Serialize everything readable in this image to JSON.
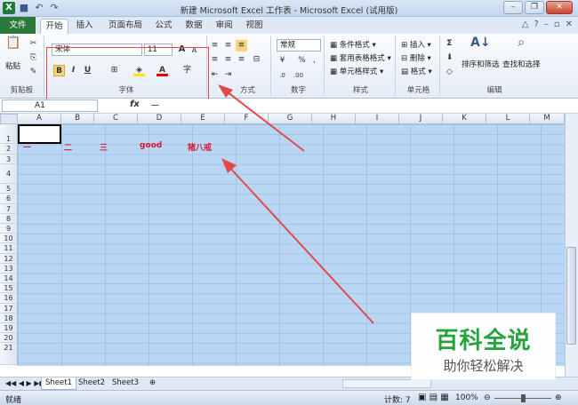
{
  "titlebar": {
    "title": "新建 Microsoft Excel 工作表 - Microsoft Excel (试用版)"
  },
  "tabs": [
    "文件",
    "开始",
    "插入",
    "页面布局",
    "公式",
    "数据",
    "审阅",
    "视图"
  ],
  "ribbon": {
    "clipboard": {
      "paste": "粘贴",
      "label": "剪贴板"
    },
    "font": {
      "name": "宋体",
      "size": "11",
      "bold": "B",
      "italic": "I",
      "underline": "U",
      "grow": "A",
      "shrink": "A",
      "label": "字体"
    },
    "alignment": {
      "label": "对齐方式",
      "visible_label": "方式"
    },
    "number": {
      "format": "常规",
      "percent": "%",
      "comma": ",",
      "label": "数字"
    },
    "styles": {
      "conditional": "条件格式",
      "table": "套用表格格式",
      "cell": "单元格样式",
      "label": "样式"
    },
    "cells": {
      "insert": "插入",
      "delete": "删除",
      "format": "格式",
      "label": "单元格"
    },
    "editing": {
      "sort": "排序和筛选",
      "find": "查找和选择",
      "label": "编辑"
    }
  },
  "formula_bar": {
    "name_box": "A1",
    "fx": "fx",
    "value": "一"
  },
  "columns": [
    "A",
    "B",
    "C",
    "D",
    "E",
    "F",
    "G",
    "H",
    "I",
    "J",
    "K",
    "L",
    "M"
  ],
  "rows": [
    "1",
    "2",
    "3",
    "4",
    "5",
    "6",
    "7",
    "8",
    "9",
    "10",
    "11",
    "12",
    "13",
    "14",
    "15",
    "16",
    "17",
    "18",
    "19",
    "20",
    "21"
  ],
  "cells": {
    "A1": "一",
    "B1": "二",
    "C1": "三",
    "D1": "good",
    "E1": "猪八戒"
  },
  "sheets": [
    "Sheet1",
    "Sheet2",
    "Sheet3"
  ],
  "status": {
    "ready": "就绪",
    "count": "计数: 7",
    "zoom": "100%"
  },
  "watermark": {
    "line1": "百科全说",
    "line2": "助你轻松解决"
  },
  "colors": {
    "cell_text": "#d9142b",
    "selection": "#b9d7f5",
    "annotation": "#e24a4a"
  }
}
